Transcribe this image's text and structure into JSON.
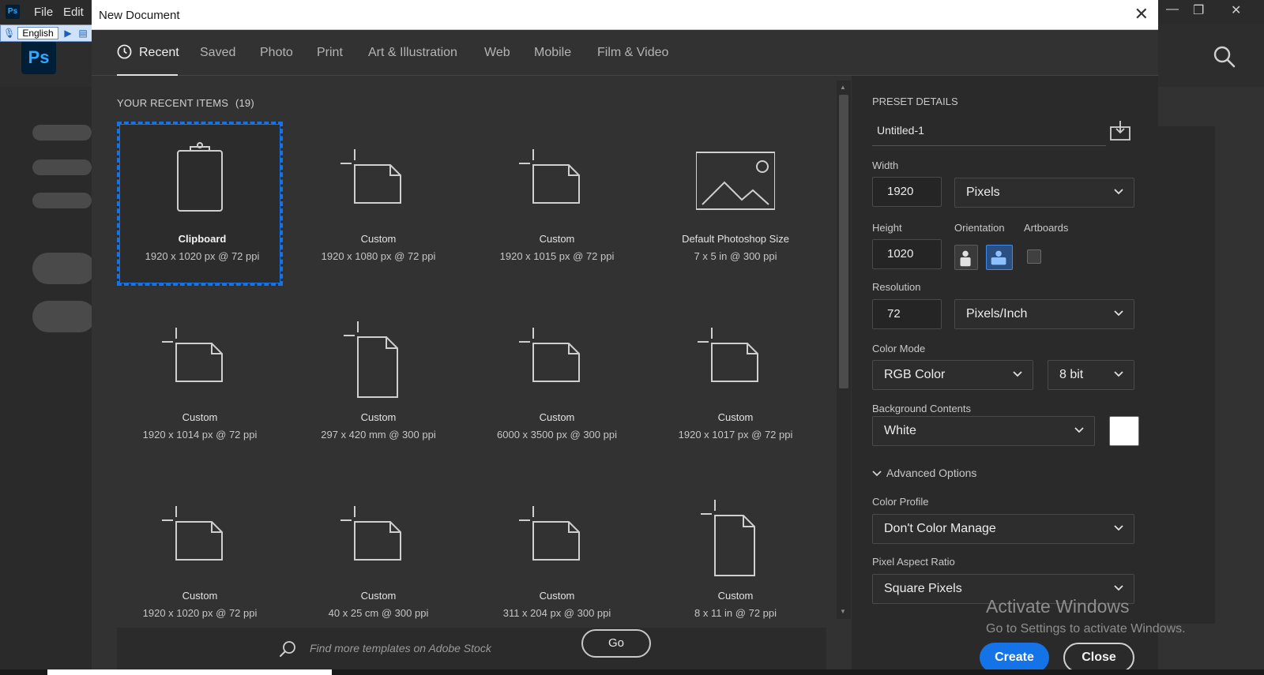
{
  "app": {
    "menu": [
      "File",
      "Edit"
    ],
    "window_controls": [
      "—",
      "❐",
      "✕"
    ]
  },
  "language_bar": {
    "language": "English"
  },
  "dialog": {
    "title": "New Document",
    "tabs": [
      {
        "label": "Recent",
        "active": true
      },
      {
        "label": "Saved"
      },
      {
        "label": "Photo"
      },
      {
        "label": "Print"
      },
      {
        "label": "Art & Illustration"
      },
      {
        "label": "Web"
      },
      {
        "label": "Mobile"
      },
      {
        "label": "Film & Video"
      }
    ],
    "recent_heading": "YOUR RECENT ITEMS",
    "recent_count": "(19)",
    "items": [
      {
        "name": "Clipboard",
        "dims": "1920 x 1020 px @ 72 ppi",
        "icon": "clipboard-icon",
        "selected": true
      },
      {
        "name": "Custom",
        "dims": "1920 x 1080 px @ 72 ppi",
        "icon": "landscape-doc-icon"
      },
      {
        "name": "Custom",
        "dims": "1920 x 1015 px @ 72 ppi",
        "icon": "landscape-doc-icon"
      },
      {
        "name": "Default Photoshop Size",
        "dims": "7 x 5 in @ 300 ppi",
        "icon": "image-icon"
      },
      {
        "name": "Custom",
        "dims": "1920 x 1014 px @ 72 ppi",
        "icon": "landscape-doc-icon"
      },
      {
        "name": "Custom",
        "dims": "297 x 420 mm @ 300 ppi",
        "icon": "portrait-doc-icon"
      },
      {
        "name": "Custom",
        "dims": "6000 x 3500 px @ 300 ppi",
        "icon": "landscape-doc-icon"
      },
      {
        "name": "Custom",
        "dims": "1920 x 1017 px @ 72 ppi",
        "icon": "landscape-doc-icon"
      },
      {
        "name": "Custom",
        "dims": "1920 x 1020 px @ 72 ppi",
        "icon": "landscape-doc-icon"
      },
      {
        "name": "Custom",
        "dims": "40 x 25 cm @ 300 ppi",
        "icon": "landscape-doc-icon"
      },
      {
        "name": "Custom",
        "dims": "311 x 204 px @ 300 ppi",
        "icon": "landscape-doc-icon"
      },
      {
        "name": "Custom",
        "dims": "8 x 11 in @ 72 ppi",
        "icon": "portrait-doc-icon"
      }
    ],
    "stock": {
      "placeholder": "Find more templates on Adobe Stock",
      "go_label": "Go"
    },
    "preset": {
      "heading": "PRESET DETAILS",
      "name": "Untitled-1",
      "width_label": "Width",
      "width_value": "1920",
      "width_unit": "Pixels",
      "height_label": "Height",
      "height_value": "1020",
      "orientation_label": "Orientation",
      "artboards_label": "Artboards",
      "resolution_label": "Resolution",
      "resolution_value": "72",
      "resolution_unit": "Pixels/Inch",
      "color_mode_label": "Color Mode",
      "color_mode": "RGB Color",
      "bit_depth": "8 bit",
      "background_label": "Background Contents",
      "background": "White",
      "advanced_label": "Advanced Options",
      "color_profile_label": "Color Profile",
      "color_profile": "Don't Color Manage",
      "pixel_aspect_label": "Pixel Aspect Ratio",
      "pixel_aspect": "Square Pixels"
    },
    "create_label": "Create",
    "close_label": "Close"
  },
  "watermark": {
    "line1": "Activate Windows",
    "line2": "Go to Settings to activate Windows."
  },
  "colors": {
    "accent": "#1473e6",
    "dialog_bg": "#323232",
    "panel_bg": "#2a2a2a"
  }
}
